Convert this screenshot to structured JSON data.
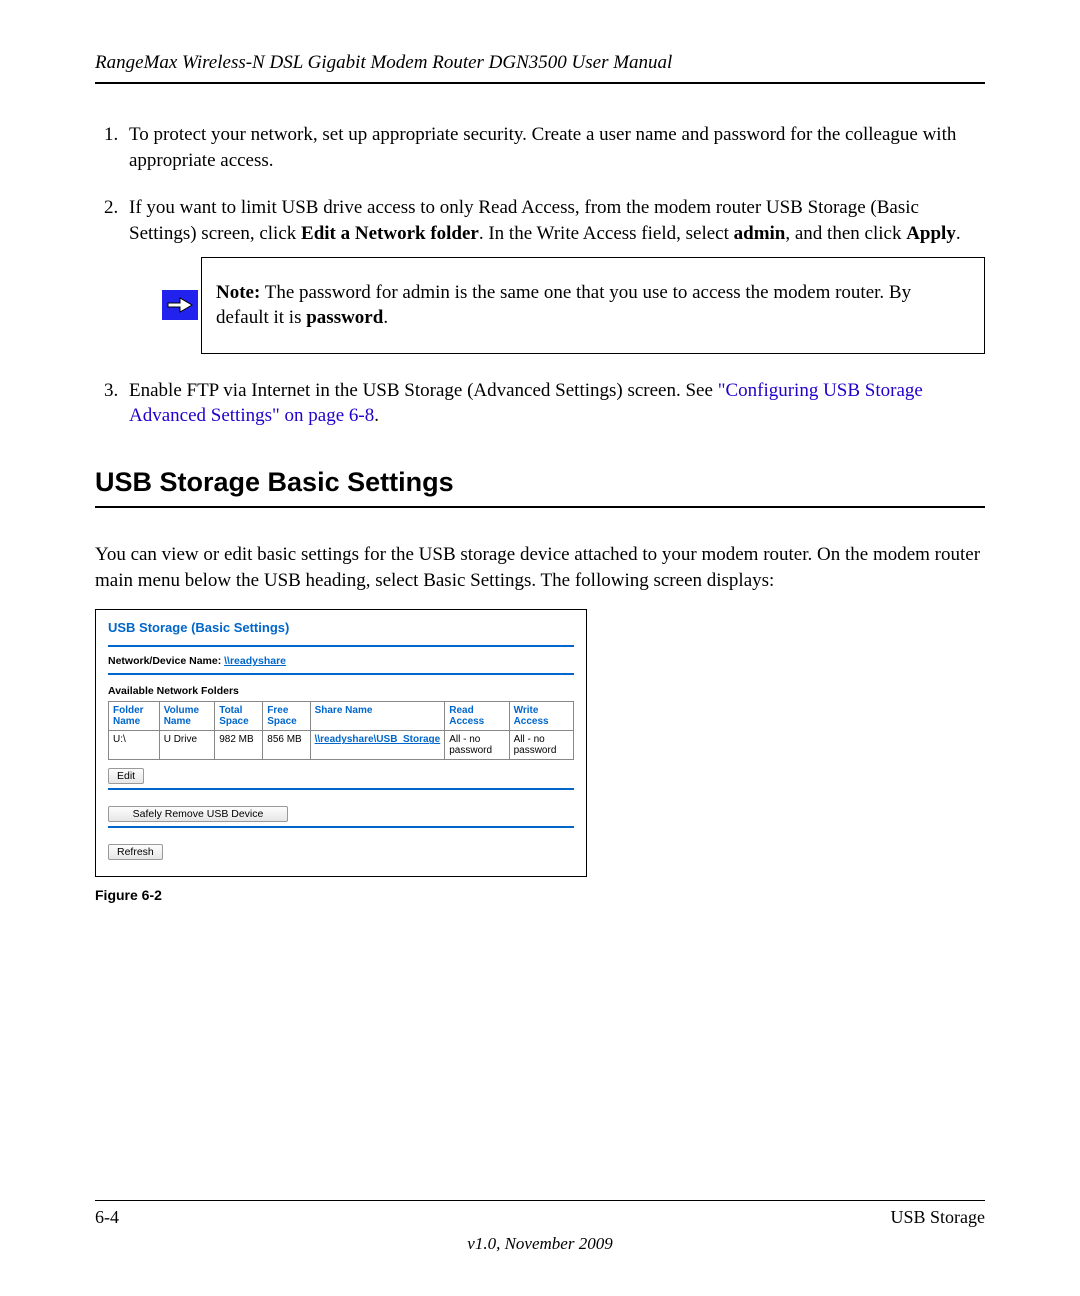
{
  "header": {
    "title": "RangeMax Wireless-N DSL Gigabit Modem Router DGN3500 User Manual"
  },
  "steps": {
    "s1": "To protect your network, set up appropriate security. Create a user name and password for the colleague with appropriate access.",
    "s2_a": "If you want to limit USB drive access to only Read Access, from the modem router USB Storage (Basic Settings) screen, click ",
    "s2_bold1": "Edit a Network folder",
    "s2_b": ". In the Write Access field, select ",
    "s2_bold2": "admin",
    "s2_c": ", and then click ",
    "s2_bold3": "Apply",
    "s2_d": ".",
    "s3_a": "Enable FTP via Internet in the USB Storage (Advanced Settings) screen. See ",
    "s3_link": "\"Configuring USB Storage Advanced Settings\" on page 6-8",
    "s3_b": "."
  },
  "note": {
    "label": "Note:",
    "text_a": " The password for admin is the same one that you use to access the modem router. By default it is ",
    "bold": "password",
    "text_b": "."
  },
  "section": {
    "title": "USB Storage Basic Settings",
    "para": "You can view or edit basic settings for the USB storage device attached to your modem router. On the modem router main menu below the USB heading, select Basic Settings. The following screen displays:"
  },
  "screenshot": {
    "title": "USB Storage (Basic Settings)",
    "nd_label": "Network/Device Name: ",
    "nd_value": "\\\\readyshare",
    "avail_label": "Available Network Folders",
    "headers": {
      "folder": "Folder Name",
      "volume": "Volume Name",
      "total": "Total Space",
      "free": "Free Space",
      "share": "Share Name",
      "read": "Read Access",
      "write": "Write Access"
    },
    "row": {
      "folder": "U:\\",
      "volume": "U Drive",
      "total": "982 MB",
      "free": "856 MB",
      "share": "\\\\readyshare\\USB_Storage",
      "read": "All - no password",
      "write": "All - no password"
    },
    "btn_edit": "Edit",
    "btn_remove": "Safely Remove USB Device",
    "btn_refresh": "Refresh"
  },
  "figure_caption": "Figure 6-2",
  "footer": {
    "page": "6-4",
    "section": "USB Storage",
    "version": "v1.0, November 2009"
  }
}
